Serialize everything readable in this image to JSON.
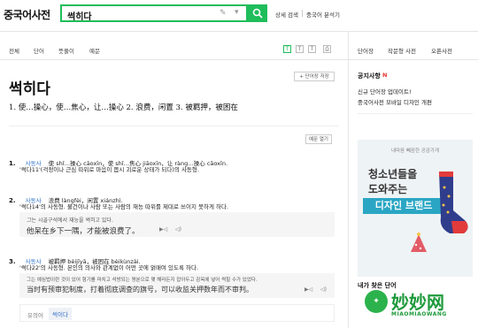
{
  "header": {
    "logo": "중국어사전",
    "search_value": "썩히다",
    "links": [
      "상세 검색",
      "중국어 분석기"
    ]
  },
  "tabs": [
    "전체",
    "단어",
    "뜻풀이",
    "예문"
  ],
  "font_controls": [
    "T",
    "T",
    "T"
  ],
  "right_nav": [
    "단어장",
    "작문형 사전",
    "오픈사전"
  ],
  "entry": {
    "word": "썩히다",
    "add_vocab": "+ 단어장 저장",
    "summary": "1. 使…操心，使…焦心，让…操心 2. 浪费，闲置 3. 被羁押，被困在",
    "example_toggle": "예문 열기",
    "senses": [
      {
        "num": "1.",
        "pos": "사동사",
        "line": "使 shǐ…操心 cāoxīn，使 shǐ…焦心 jiāoxīn，让 ràng…操心 cāoxīn.",
        "desc": "'썩다11'(걱정이나 근심 따위로 마음이 몹시 괴로운 상태가 되다)의 사동형."
      },
      {
        "num": "2.",
        "pos": "사동사",
        "line": "浪费 làngfèi，闲置 xiánzhì.",
        "desc": "'썩다14'의 사동형. 물건이나 사람 또는 사람의 재능 따위를 제대로 쓰이지 못하게 하다.",
        "ex_ko": "그는 시골구석에서 재능을 썩히고 있다.",
        "ex_zh": "他呆在乡下一隅，才能被浪费了。"
      },
      {
        "num": "3.",
        "pos": "사동사",
        "line": "被羁押 bèijīyā，被困在 bèikùnzài.",
        "desc": "'썩다22'의 사동형. 본인의 의사와 관계없이 어떤 곳에 얽매여 있도록 하다.",
        "ex_ko": "그는 예심법이란 것이 있어 형기를 마치고 석방되는 명분으로 몇 해라든지 잡아두고 감옥에 넣어 썩힐 수가 있었다.",
        "ex_zh": "当时有预审犯制度，打着彻底调查的旗号，可以收监关押数年而不审判。"
      }
    ],
    "related_label": "유의어",
    "related_word": "썩이다"
  },
  "sidebar": {
    "notice_title": "공지사항",
    "notice_badge": "N",
    "notices": [
      "신규 단어장 업데이트!",
      "중국어사전 모바일 디자인 개편"
    ],
    "ad_small": "내마음 빼꼼한 공감가게",
    "ad_line1": "청소년들을",
    "ad_line2": "도와주는",
    "ad_banner": "디자인 브랜드",
    "found_title": "내가 찾은 단어",
    "watermark_cn": "妙妙网",
    "watermark_en": "MIAOMIAOWANG"
  },
  "colors": {
    "accent": "#1fbd5b",
    "pos": "#2e6fc7",
    "sock": "#2f3d8c",
    "sock_toe": "#e23b3b"
  }
}
